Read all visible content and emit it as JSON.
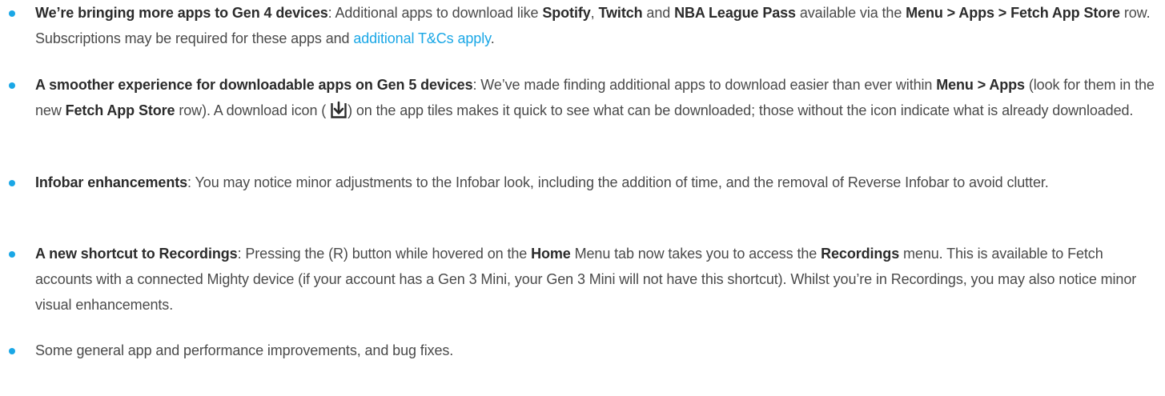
{
  "items": [
    {
      "title": "We’re bringing more apps to Gen 4 devices",
      "sep": ": Additional apps to download like ",
      "spotify": "Spotify",
      "comma": ", ",
      "twitch": "Twitch",
      "and": " and ",
      "nba": "NBA League Pass",
      "via": " available via the ",
      "path": "Menu > Apps > Fetch App Store",
      "rest": " row. Subscriptions may be required for these apps and ",
      "link": "additional T&Cs apply",
      "end": "."
    },
    {
      "title": "A smoother experience for downloadable apps on Gen 5 devices",
      "sep": ": We’ve made finding additional apps to download easier than ever within ",
      "path": "Menu > Apps",
      "mid": " (look for them in the new ",
      "store": "Fetch App Store",
      "mid2": " row). A download icon ( ",
      "icon": "download-icon",
      "rest": ") on the app tiles makes it quick to see what can be downloaded; those without the icon indicate what is already downloaded."
    },
    {
      "title": "Infobar enhancements",
      "rest": ": You may notice minor adjustments to the Infobar look, including the addition of time, and the removal of Reverse Infobar to avoid clutter."
    },
    {
      "title": "A new shortcut to Recordings",
      "sep": ": Pressing the (R) button while hovered on the ",
      "home": "Home",
      "mid": " Menu tab now takes you to access the ",
      "recordings": "Recordings",
      "rest": " menu. This is available to Fetch accounts with a connected Mighty device (if your account has a Gen 3 Mini, your Gen 3 Mini will not have this shortcut). Whilst you’re in Recordings, you may also notice minor visual enhancements."
    },
    {
      "text": "Some general app and performance improvements, and bug fixes."
    }
  ],
  "colors": {
    "accent": "#1aa7e6",
    "text": "#4a4a4a"
  }
}
